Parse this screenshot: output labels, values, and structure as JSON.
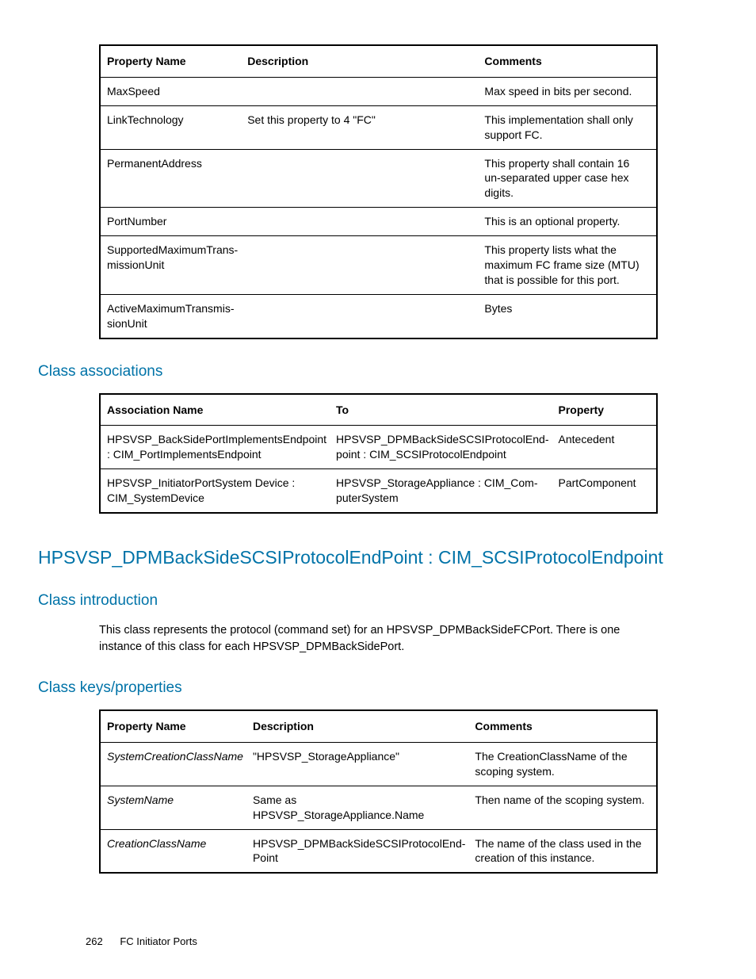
{
  "table1": {
    "headers": [
      "Property Name",
      "Description",
      "Comments"
    ],
    "rows": [
      {
        "c0": "MaxSpeed",
        "c1": "",
        "c2": "Max speed in bits per second."
      },
      {
        "c0": "LinkTechnology",
        "c1": "Set this property to 4 \"FC\"",
        "c2": "This implementation shall only support FC."
      },
      {
        "c0": "PermanentAddress",
        "c1": "",
        "c2": "This property shall contain 16 un-separated upper case hex digits."
      },
      {
        "c0": "PortNumber",
        "c1": "",
        "c2": "This is an optional property."
      },
      {
        "c0": "SupportedMaximumTrans­missionUnit",
        "c1": "",
        "c2": "This property lists what the maximum FC frame size (MTU) that is possible for this port."
      },
      {
        "c0": "ActiveMaximumTransmis­sionUnit",
        "c1": "",
        "c2": "Bytes"
      }
    ]
  },
  "sec_assoc": "Class associations",
  "table2": {
    "headers": [
      "Association Name",
      "To",
      "Property"
    ],
    "rows": [
      {
        "c0": "HPSVSP_BackSidePortImplementsEndpoint : CIM_PortImplementsEndpoint",
        "c1": "HPSVSP_DPMBackSideSCSIProtocolEnd­point : CIM_SCSIProtocolEndpoint",
        "c2": "Antecedent"
      },
      {
        "c0": "HPSVSP_InitiatorPortSystem Device : CIM_SystemDevice",
        "c1": "HPSVSP_StorageAppliance : CIM_Com­puterSystem",
        "c2": "PartComponent"
      }
    ]
  },
  "mainhead": "HPSVSP_DPMBackSideSCSIProtocolEndPoint : CIM_SCSIProtocolEndpoint",
  "sec_intro": "Class introduction",
  "intro_body": "This class represents the protocol (command set) for an HPSVSP_DPMBackSideFCPort. There is one instance of this class for each HPSVSP_DPMBackSidePort.",
  "sec_keys": "Class keys/properties",
  "table3": {
    "headers": [
      "Property Name",
      "Description",
      "Comments"
    ],
    "rows": [
      {
        "c0": "SystemCreationClassName",
        "c1": "\"HPSVSP_StorageAppliance\"",
        "c2": "The CreationClassName of the scoping system."
      },
      {
        "c0": "SystemName",
        "c1": "Same as HPSVSP_StorageAppliance.Name",
        "c2": "Then name of the scoping system."
      },
      {
        "c0": "CreationClassName",
        "c1": "HPSVSP_DPMBackSideSCSIProtocolEnd­Point",
        "c2": "The name of the class used in the cre­ation of this instance."
      }
    ]
  },
  "footer": {
    "pagenum": "262",
    "section": "FC Initiator Ports"
  }
}
